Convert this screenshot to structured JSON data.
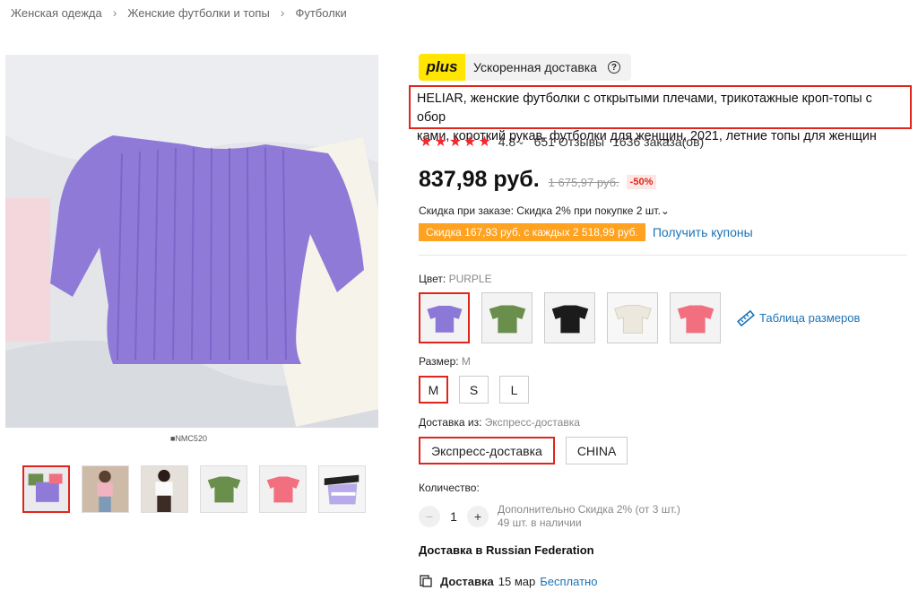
{
  "breadcrumb": [
    "Женская одежда",
    "Женские футболки и топы",
    "Футболки"
  ],
  "image": {
    "caption": "NMC520"
  },
  "thumbnails": [
    "purple-top",
    "woman-pink",
    "woman-white",
    "green-top",
    "pink-top",
    "lavender-striped"
  ],
  "plus": {
    "badge": "plus",
    "text": "Ускоренная доставка"
  },
  "product": {
    "title_line1": "HELIAR, женские футболки с открытыми плечами, трикотажные кроп-топы с обор",
    "title_line2": "ками, короткий рукав, футболки для женщин, 2021, летние топы для женщин",
    "stars": "★★★★★",
    "rating": "4.8",
    "reviews": "651 Отзывы",
    "orders": "1636 заказа(ов)"
  },
  "price": {
    "current": "837,98 руб.",
    "old": "1 675,97 руб.",
    "discount": "-50%"
  },
  "order_discount": "Скидка при заказе: Скидка 2% при покупке 2 шт.",
  "coupon": {
    "tag": "Скидка 167,93 руб. с каждых 2 518,99 руб.",
    "link": "Получить купоны"
  },
  "color": {
    "label": "Цвет:",
    "value": "PURPLE",
    "swatches": [
      "#8c78d6",
      "#6a8f4c",
      "#1b1b1b",
      "#ece8dd",
      "#f26f7f"
    ]
  },
  "size_table": "Таблица размеров",
  "size": {
    "label": "Размер:",
    "value": "M",
    "options": [
      "M",
      "S",
      "L"
    ]
  },
  "shipping": {
    "label": "Доставка из:",
    "value": "Экспресс-доставка",
    "options": [
      "Экспресс-доставка",
      "CHINA"
    ]
  },
  "quantity": {
    "label": "Количество:",
    "value": "1",
    "info_line1": "Дополнительно Скидка 2% (от 3 шт.)",
    "info_line2": "49 шт. в наличии"
  },
  "delivery": {
    "heading": "Доставка в Russian Federation",
    "label": "Доставка",
    "date": "15 мар",
    "cost": "Бесплатно"
  },
  "colors": {
    "accent": "#e1251b",
    "link": "#1a73b8",
    "coupon": "#ffa21f",
    "plus": "#ffe500"
  }
}
